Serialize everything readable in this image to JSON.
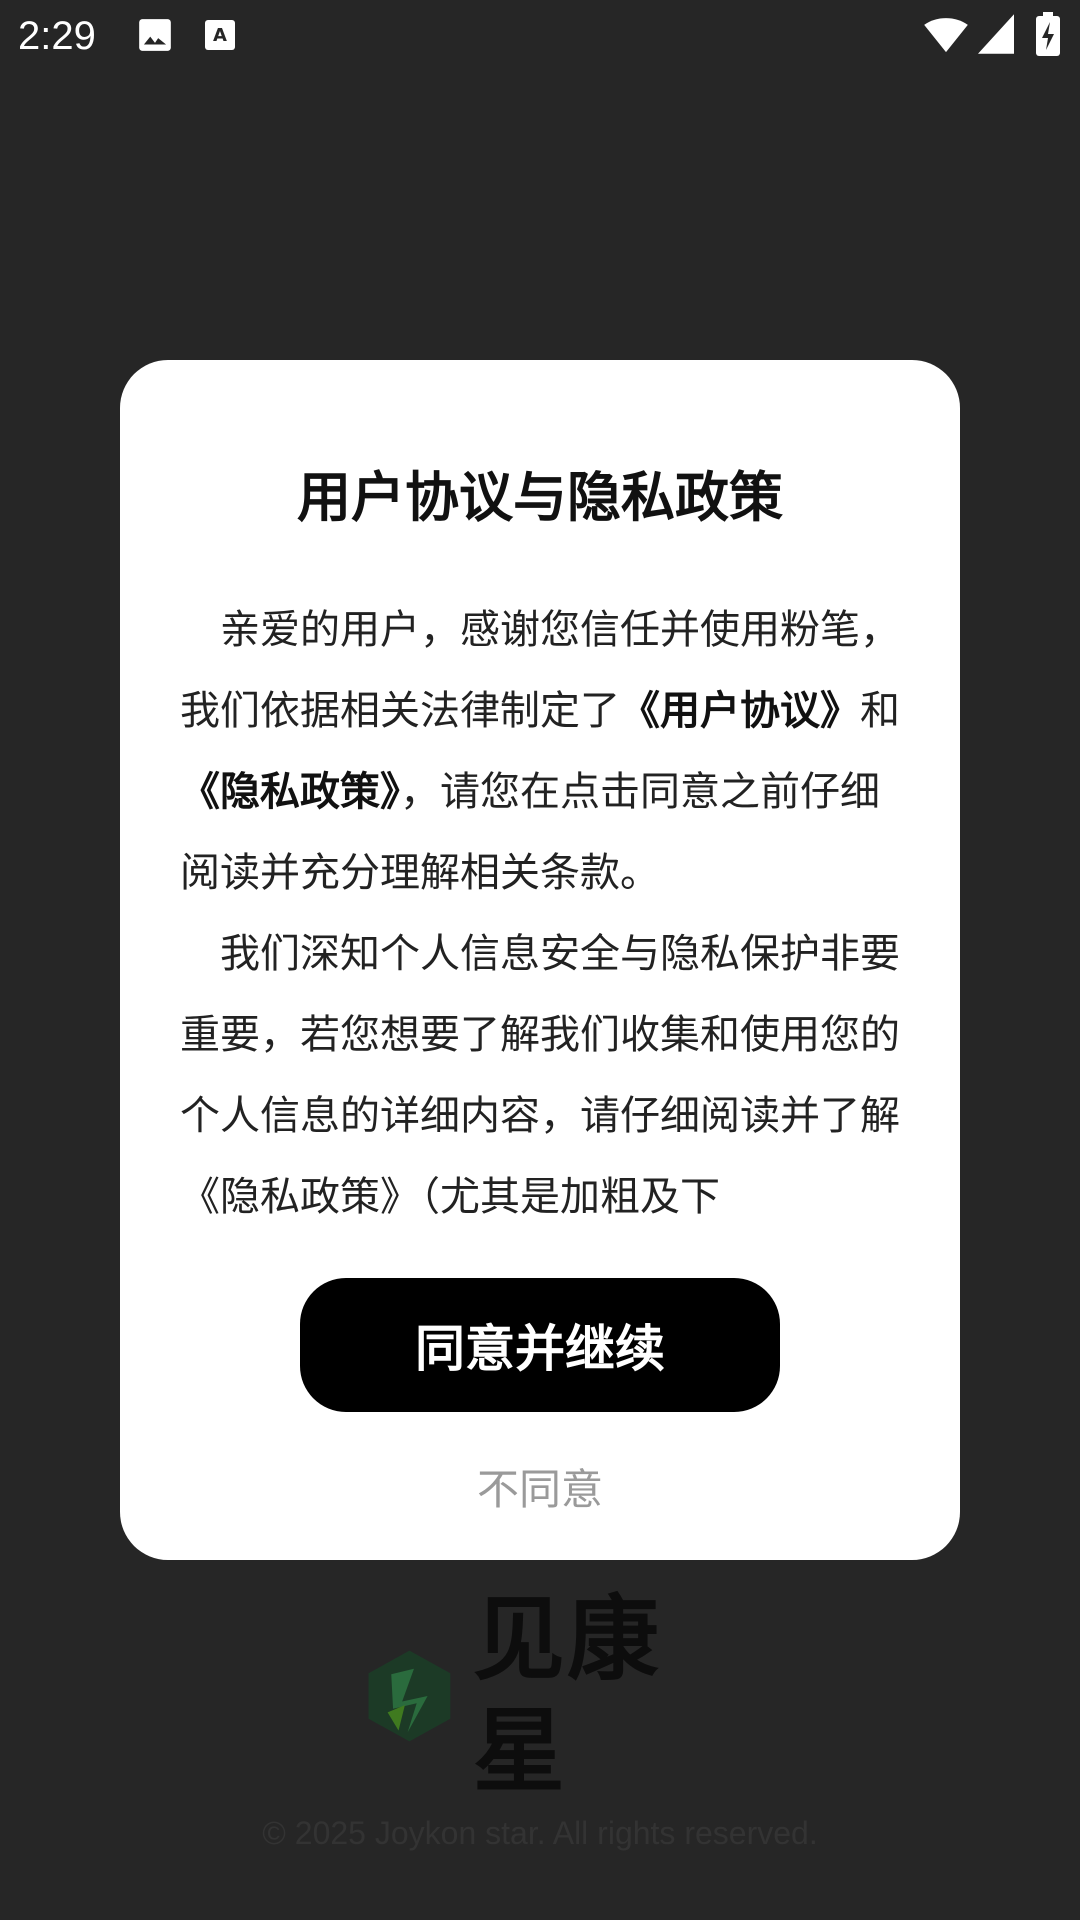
{
  "status_bar": {
    "time": "2:29",
    "icons": [
      "image-icon",
      "text-recognition-icon",
      "wifi-icon",
      "signal-icon",
      "battery-charging-icon"
    ]
  },
  "dialog": {
    "title": "用户协议与隐私政策",
    "paragraph1": {
      "part1": "亲爱的用户，感谢您信任并使用粉笔，我们依据相关法律制定了",
      "user_agreement_link": "《用户协议》",
      "part2": "和",
      "privacy_policy_link": "《隐私政策》",
      "part3": "，请您在点击同意之前仔细阅读并充分理解相关条款。"
    },
    "paragraph2": "我们深知个人信息安全与隐私保护非要重要，若您想要了解我们收集和使用您的个人信息的详细内容，请仔细阅读并了解《隐私政策》（尤其是加粗及下",
    "agree_label": "同意并继续",
    "disagree_label": "不同意"
  },
  "splash": {
    "logo_text": "见康星",
    "copyright": "© 2025 Joykon star. All rights reserved."
  },
  "colors": {
    "background": "#262626",
    "dialog_bg": "#ffffff",
    "primary_button": "#000000",
    "secondary_text": "#9a9a9a",
    "logo_green": "#1e5a34"
  }
}
